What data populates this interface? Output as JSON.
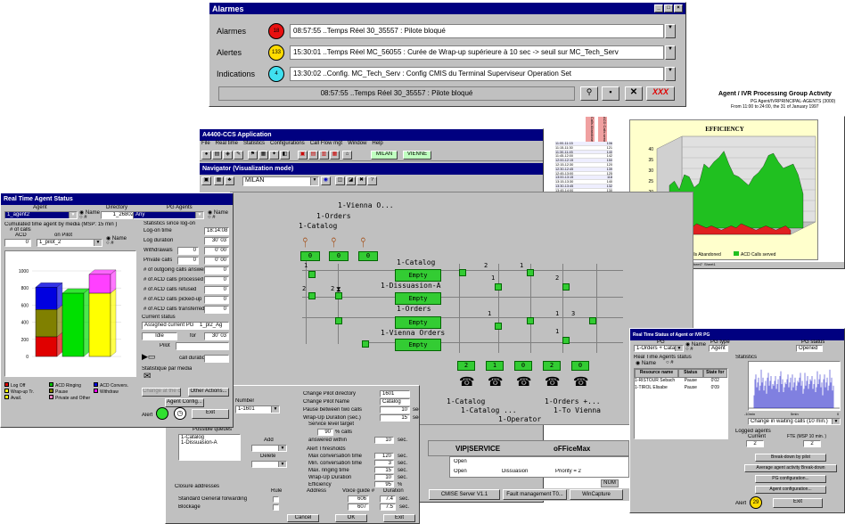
{
  "alarms": {
    "title": "Alarmes",
    "rows": [
      {
        "label": "Alarmes",
        "count": "18",
        "color": "#e81010",
        "text": "08:57:55 ..Temps Réel 30_35557 : Pilote bloqué"
      },
      {
        "label": "Alertes",
        "count": "133",
        "color": "#ffdc00",
        "text": "15:30:01 ..Temps Réel MC_56055 : Curée de Wrap-up supérieure à 10 sec -> seuil sur MC_Tech_Serv"
      },
      {
        "label": "Indications",
        "count": "4",
        "color": "#40e0f0",
        "text": "13:30:02 ..Config. MC_Tech_Serv : Config CMIS du Terminal Superviseur Operation Set"
      }
    ],
    "status": "08:57:55 ..Temps Réel 30_35557 : Pilote bloqué",
    "xxx": "XXX"
  },
  "report": {
    "title": "Agent / IVR Processing Group Activity",
    "sub1": "PG Agent/IVRPRINCIPAL-AGENTS (3000)",
    "sub2": "From 11:00 to 24:00, the 31 of January 1997"
  },
  "sheet": {
    "col1": "Calls Abandoned",
    "col2": "ACD Calls served",
    "rows": [
      [
        "11:00-11:15",
        "106"
      ],
      [
        "11:15-11:30",
        "121"
      ],
      [
        "11:30-11:45",
        "140"
      ],
      [
        "11:45-12:00",
        "142"
      ],
      [
        "12:00-12:15",
        "150"
      ],
      [
        "12:15-12:30",
        "120"
      ],
      [
        "12:30-12:45",
        "139"
      ],
      [
        "12:45-13:00",
        "125"
      ],
      [
        "13:00-13:15",
        "118"
      ],
      [
        "13:15-13:30",
        "140"
      ],
      [
        "13:30-13:45",
        "132"
      ],
      [
        "13:45-14:00",
        "130"
      ],
      [
        "14:00-14:15",
        "142"
      ],
      [
        "14:15-14:30",
        "120"
      ],
      [
        "14:30-14:45",
        "124"
      ],
      [
        "14:45-15:00",
        "138"
      ],
      [
        "15:00-15:15",
        "150"
      ],
      [
        "15:15-15:30",
        "141"
      ],
      [
        "15:30-15:45",
        "152"
      ],
      [
        "15:45-16:00",
        "148"
      ],
      [
        "16:00-16:15",
        "158"
      ],
      [
        "16:15-16:30",
        "160"
      ],
      [
        "16:30-16:45",
        "155"
      ],
      [
        "16:45-17:00",
        "142"
      ],
      [
        "17:00-17:15",
        "138"
      ],
      [
        "17:15-17:30",
        "140"
      ],
      [
        "17:30-17:45",
        "120"
      ],
      [
        "17:45-18:00",
        "109"
      ]
    ],
    "tabs": [
      "General",
      "Graphe 1 Résumé",
      "Graphe 2 Résumé",
      "Graphe 3 Résumé",
      "Graphe 4 Résumé",
      "Sheet7",
      "Sheet1"
    ]
  },
  "chart_data": {
    "type": "area",
    "title": "EFFICIENCY",
    "series": [
      {
        "name": "Calls Abandoned",
        "color": "#e02020",
        "values": [
          3,
          4,
          3,
          5,
          4,
          3,
          4,
          3,
          5,
          4,
          3,
          4,
          3,
          2,
          3,
          4,
          3,
          5,
          4,
          3,
          2,
          3,
          4,
          3,
          2,
          3,
          4,
          2
        ]
      },
      {
        "name": "ACD Calls served",
        "color": "#20c020",
        "values": [
          20,
          22,
          18,
          25,
          24,
          19,
          21,
          30,
          28,
          31,
          33,
          36,
          30,
          25,
          24,
          22,
          20,
          24,
          26,
          29,
          34,
          35,
          31,
          28,
          29,
          30,
          25,
          16
        ]
      }
    ],
    "yticks": [
      "0",
      "5",
      "10",
      "15",
      "20",
      "25",
      "30",
      "35",
      "40"
    ],
    "ylim": [
      0,
      40
    ]
  },
  "app": {
    "title": "A4400-CCS Application",
    "menu": [
      "File",
      "Real time",
      "Statistics",
      "Configurations",
      "Call Flow mgt",
      "Window",
      "Help"
    ],
    "sites": [
      "MILAN",
      "VIENNE"
    ],
    "nav_title": "Navigator (Visualization mode)",
    "nav_site": "MILAN"
  },
  "flow": {
    "labels": [
      "1-Vienna O...",
      "1-Orders",
      "1-Catalog",
      "1-Catalog",
      "1-Dissuasion-A",
      "1-Orders",
      "1-Vienna Orders",
      "1-Catalog",
      "1-Catalog ...",
      "1-Orders +...",
      "1-To Vienna",
      "1-Operator"
    ],
    "empty": "Empty",
    "small": [
      "0",
      "0",
      "0",
      "2",
      "1",
      "0",
      "2",
      "0"
    ],
    "nums": [
      "1",
      "1",
      "2",
      "2",
      "2",
      "2",
      "1",
      "1",
      "3",
      "1",
      "1"
    ]
  },
  "rtas": {
    "title": "Real Time Agent Status",
    "agent_lbl": "Agent",
    "directory_lbl": "Directory",
    "pg_lbl": "PG Agents",
    "agent_val": "1_agent2",
    "dir_val": "1_26802",
    "pg_val": "Any",
    "name": "Name",
    "num": "#",
    "cum": "Cumulated time agent by media (MSP: 15 min )",
    "calls": "# of calls",
    "acd": "ACD",
    "onpilot": "on Pilot",
    "acd_val": "0",
    "pilot_val": "1_pilot_2",
    "stats_lbl": "Statistics since log-on",
    "stats": [
      [
        "Log-on time",
        "18:14:08"
      ],
      [
        "Log duration",
        "30' 03"
      ],
      [
        "Withdrawals",
        "0' 00"
      ],
      [
        "Private calls",
        "0' 00"
      ],
      [
        "# of outgoing calls answered",
        "0"
      ],
      [
        "# of ACD calls processed",
        "0"
      ],
      [
        "# of ACD calls refused",
        "0"
      ],
      [
        "# of ACD calls picked-up",
        "0"
      ],
      [
        "# of ACD calls transferred",
        "0"
      ]
    ],
    "wd_val": "0",
    "pc_val": "0",
    "cur": "Current status",
    "assigned": "Assigned current PG",
    "assigned_val": "1_pl2_Ag",
    "idle": "Idle",
    "for": "for",
    "for_val": "30' 03",
    "pilot": "Pilot",
    "callduration": "call duration",
    "statmedia": "Statistique par media",
    "yticks": [
      "1000",
      "800",
      "600",
      "400",
      "200",
      "0"
    ],
    "legend": [
      [
        "#e00000",
        "Log Off"
      ],
      [
        "#00c000",
        "ACD Ringing"
      ],
      [
        "#0000e0",
        "ACD Convers."
      ],
      [
        "#ffff00",
        "Wrap-up Tr."
      ],
      [
        "#808000",
        "Pause"
      ],
      [
        "#ff00ff",
        "Withdraw"
      ],
      [
        "#ffff00",
        "Avail."
      ],
      [
        "#ff80c0",
        "Private and Other"
      ]
    ],
    "btns": [
      "Change at the call",
      "Other Actions...",
      "Agent Config...",
      "Exit"
    ],
    "alert": "Alert"
  },
  "cfg": {
    "number_lbl": "Number",
    "number_val": "1-1601",
    "rows": [
      [
        "Change Pilot directory",
        "1601",
        ""
      ],
      [
        "Change Pilot Name",
        "Catalog",
        ""
      ],
      [
        "Pause between two calls",
        "10",
        "sec."
      ],
      [
        "Wrap-Up Duration (sec.)",
        "15",
        "sec."
      ]
    ],
    "slt": "Service level target",
    "slt_val": "90",
    "pcalls": "% calls",
    "answ": "answered within",
    "answ_val": "10",
    "threshold": "Alert Thresholds",
    "th": [
      [
        "Max conversation time",
        "120",
        "sec."
      ],
      [
        "Min. conversation time",
        "3",
        "sec."
      ],
      [
        "Max. ringing time",
        "15",
        "sec."
      ],
      [
        "Wrap-Up Duration",
        "10",
        "sec."
      ],
      [
        "Efficiency",
        "95",
        "%"
      ]
    ],
    "queues": "Possible queues",
    "q1": "1-Catalog",
    "q2": "1-Dissuasion-A",
    "add": "Add",
    "delete": "Delete",
    "closure": "Closure addresses",
    "cols": [
      "Rule",
      "Address",
      "Voice guide #",
      "Duration"
    ],
    "cl": [
      [
        "Standard General forwarding",
        "606",
        "7.4",
        "sec."
      ],
      [
        "Blockage",
        "607",
        "7.5",
        "sec."
      ]
    ],
    "btns": [
      "Cancel",
      "OK",
      "Exit"
    ]
  },
  "bg": {
    "vip": "VIP|SERVICE",
    "office": "oFFiceMax",
    "open1": "Open",
    "open2": "Open",
    "dissuasion": "Dissuasion",
    "priority": "Priority = 2",
    "num": "NUM"
  },
  "taskbar": [
    "CMISE Server V1.1",
    "Fault management T0...",
    "WinCapture"
  ],
  "rtpg": {
    "title": "Real Time Status of Agent or IVR PG",
    "pg_lbl": "PG",
    "pgtype_lbl": "PG type",
    "pgstatus_lbl": "PG status",
    "pg_val": "1-Orders + Catalog",
    "pgtype_val": "Agent",
    "pgstatus_val": "Opened",
    "rta": "Real Time Agents status",
    "name": "Name",
    "num": "#",
    "stats_lbl": "Statistics",
    "cols": [
      "Resource name",
      "Status",
      "State for"
    ],
    "rows": [
      [
        "1-RISTOUR Sebach",
        "Pause",
        "0'02"
      ],
      [
        "1-TIROL Elisabe",
        "Pause",
        "0'09"
      ]
    ],
    "axis_l": "-10min",
    "axis_m": "5min",
    "axis_r": "0",
    "change": "Change in waiting calls (10 min.)",
    "logged": "Logged agents",
    "current": "Current",
    "fte": "FTE (MSP 10 min. )",
    "cur_val": "2",
    "fte_val": "2",
    "btns": [
      "Break-down by pilot",
      "Average agent activity Break-down",
      "PG configuration...",
      "Agent configuration...",
      "Exit"
    ],
    "alert": "Alert",
    "alert_val": "29"
  }
}
